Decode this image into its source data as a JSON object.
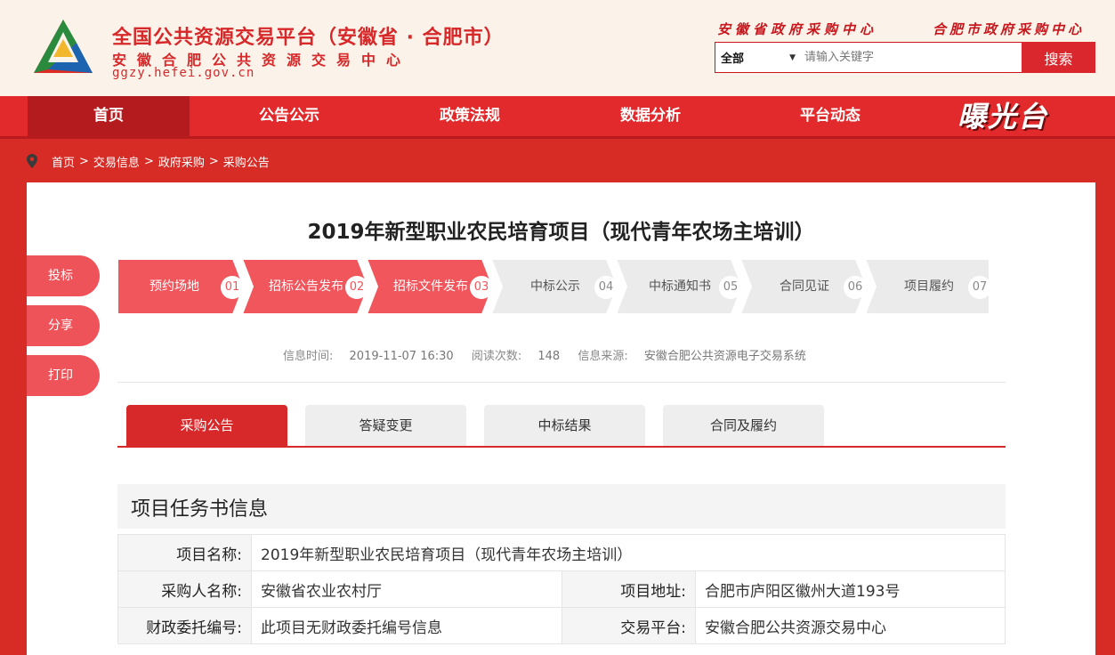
{
  "header": {
    "title_main": "全国公共资源交易平台（安徽省 · 合肥市）",
    "title_sub": "安徽合肥公共资源交易中心",
    "url": "ggzy.hefei.gov.cn",
    "center_left": "安徽省政府采购中心",
    "center_right": "合肥市政府采购中心",
    "search": {
      "category": "全部",
      "placeholder": "请输入关键字",
      "button": "搜索"
    }
  },
  "nav": {
    "items": [
      "首页",
      "公告公示",
      "政策法规",
      "数据分析",
      "平台动态"
    ],
    "brand": "曝光台"
  },
  "breadcrumb": [
    "首页",
    "交易信息",
    "政府采购",
    "采购公告"
  ],
  "page": {
    "title": "2019年新型职业农民培育项目（现代青年农场主培训）"
  },
  "side_actions": [
    "投标",
    "分享",
    "打印"
  ],
  "steps": [
    {
      "label": "预约场地",
      "num": "01",
      "done": true
    },
    {
      "label": "招标公告发布",
      "num": "02",
      "done": true
    },
    {
      "label": "招标文件发布",
      "num": "03",
      "done": true
    },
    {
      "label": "中标公示",
      "num": "04",
      "done": false
    },
    {
      "label": "中标通知书",
      "num": "05",
      "done": false
    },
    {
      "label": "合同见证",
      "num": "06",
      "done": false
    },
    {
      "label": "项目履约",
      "num": "07",
      "done": false
    }
  ],
  "meta": {
    "time_label": "信息时间:",
    "time": "2019-11-07 16:30",
    "views_label": "阅读次数:",
    "views": "148",
    "source_label": "信息来源:",
    "source": "安徽合肥公共资源电子交易系统"
  },
  "tabs": [
    "采购公告",
    "答疑变更",
    "中标结果",
    "合同及履约"
  ],
  "section": {
    "title": "项目任务书信息",
    "rows": {
      "name_label": "项目名称:",
      "name": "2019年新型职业农民培育项目（现代青年农场主培训）",
      "buyer_label": "采购人名称:",
      "buyer": "安徽省农业农村厅",
      "address_label": "项目地址:",
      "address": "合肥市庐阳区徽州大道193号",
      "fiscal_label": "财政委托编号:",
      "fiscal": "此项目无财政委托编号信息",
      "platform_label": "交易平台:",
      "platform": "安徽合肥公共资源交易中心"
    }
  },
  "colors": {
    "brand_red": "#d7282a",
    "step_done": "#f0565c",
    "step_todo": "#ebebeb"
  }
}
